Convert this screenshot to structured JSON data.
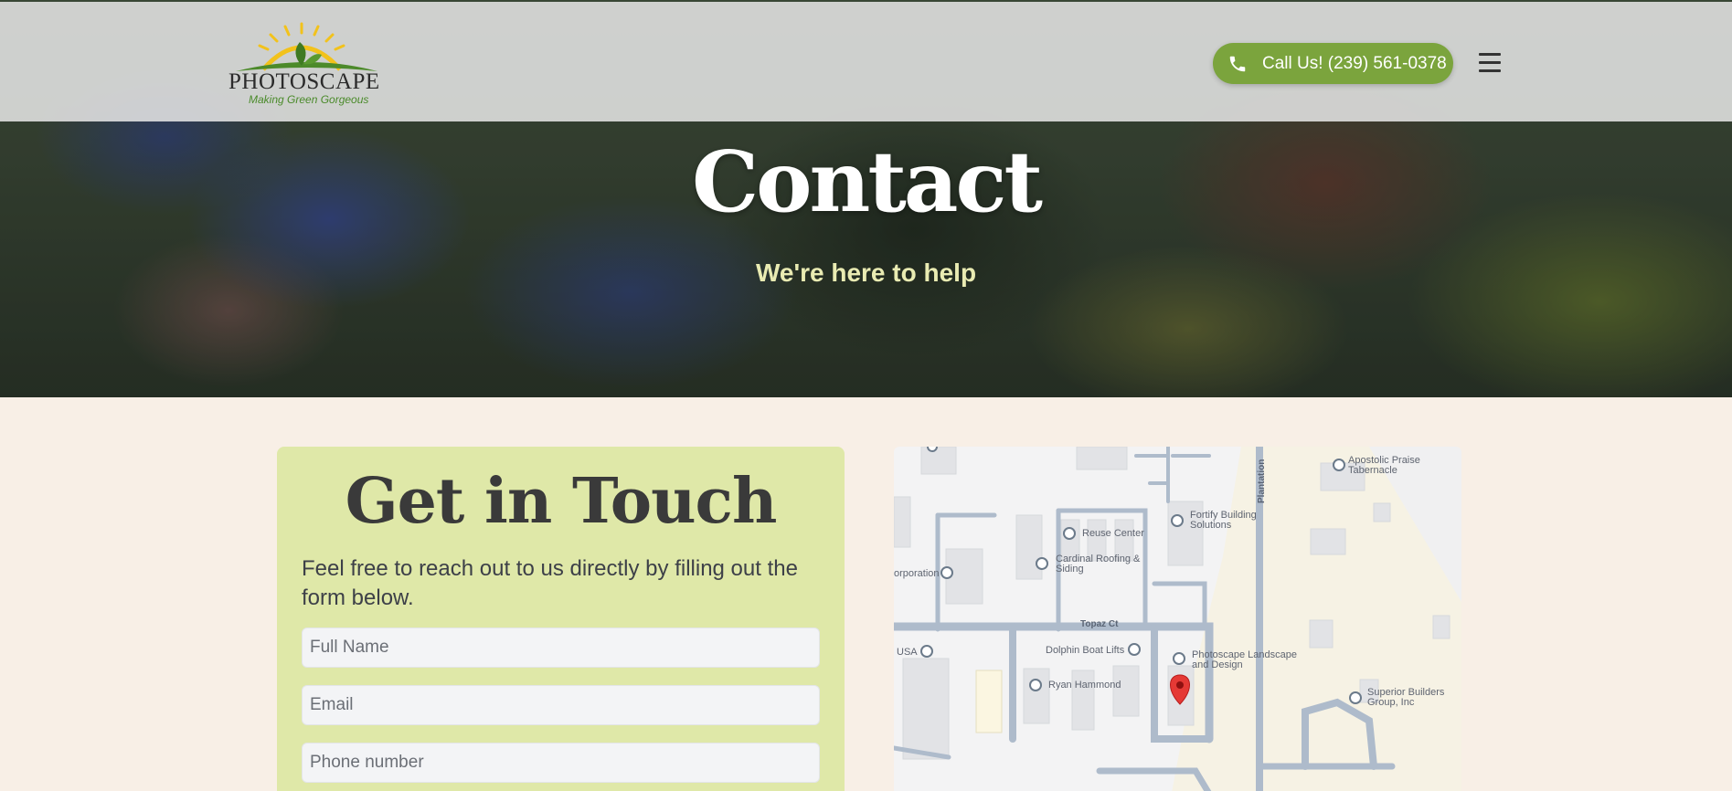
{
  "header": {
    "logo": {
      "name": "PHOTOSCAPE",
      "tagline": "Making Green Gorgeous"
    },
    "call_button": {
      "label": "Call Us! (239) 561-0378",
      "icon": "phone-icon"
    },
    "menu_icon": "hamburger-menu-icon"
  },
  "hero": {
    "title": "Contact",
    "subtitle": "We're here to help"
  },
  "form": {
    "title": "Get in Touch",
    "description": "Feel free to reach out to us directly by filling out the form below.",
    "fields": {
      "full_name": {
        "placeholder": "Full Name",
        "value": ""
      },
      "email": {
        "placeholder": "Email",
        "value": ""
      },
      "phone": {
        "placeholder": "Phone number",
        "value": ""
      }
    }
  },
  "map": {
    "labels": {
      "apostolic": "Apostolic Praise Tabernacle",
      "fortify": "Fortify Building Solutions",
      "reuse": "Reuse Center",
      "cardinal": "Cardinal Roofing & Siding",
      "corporation": "orporation",
      "topaz": "Topaz Ct",
      "dolphin": "Dolphin Boat Lifts",
      "usa": "USA",
      "photoscape": "Photoscape Landscape and Design",
      "ryan": "Ryan Hammond",
      "superior": "Superior Builders Group, Inc",
      "plantation": "Plantation"
    }
  },
  "colors": {
    "accent_green": "#7ba43d",
    "card_bg": "#dfe8a8",
    "page_bg": "#f8efe6",
    "subtitle": "#e9ebb2"
  }
}
